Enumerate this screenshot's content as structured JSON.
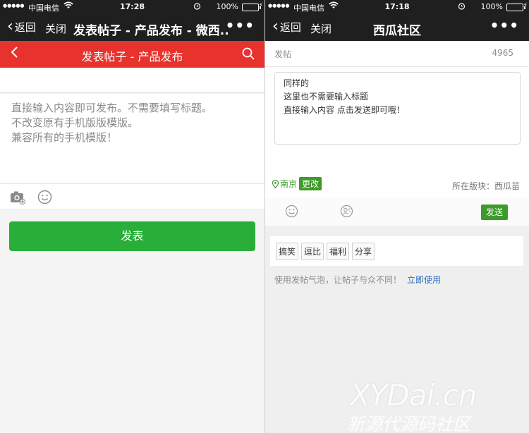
{
  "left": {
    "status": {
      "carrier": "中国电信",
      "time": "17:28",
      "battery": "100%",
      "battery_level": 1.0
    },
    "wx": {
      "back": "返回",
      "close": "关闭",
      "title": "发表帖子 - 产品发布 - 微西...",
      "more": "•••"
    },
    "header": {
      "title": "发表帖子 - 产品发布"
    },
    "editor": {
      "placeholder_lines": [
        "直接输入内容即可发布。不需要填写标题。",
        "不改变原有手机版版模版。",
        "兼容所有的手机模版！"
      ]
    },
    "publish_label": "发表"
  },
  "right": {
    "status": {
      "carrier": "中国电信",
      "time": "17:18",
      "battery": "100%",
      "battery_level": 1.0
    },
    "wx": {
      "back": "返回",
      "close": "关闭",
      "title": "西瓜社区",
      "more": "•••"
    },
    "section": {
      "label": "发帖",
      "count": "4965"
    },
    "textarea_lines": [
      "同样的",
      "这里也不需要输入标题",
      "直接输入内容 点击发送即可哦！"
    ],
    "location": {
      "city": "南京",
      "change": "更改"
    },
    "board": "所在版块：西瓜苗",
    "send_label": "发送",
    "tags": [
      "搞笑",
      "逗比",
      "福利",
      "分享"
    ],
    "hint": {
      "text": "使用发帖气泡，让帖子与众不同！",
      "link": "立即使用"
    },
    "watermark": {
      "line1": "XYDai.cn",
      "line2": "新源代源码社区"
    }
  },
  "colors": {
    "brand_red": "#e7322d",
    "brand_green": "#2aae3a",
    "accent_green": "#3d9a2b",
    "link_blue": "#2b6fbf"
  }
}
